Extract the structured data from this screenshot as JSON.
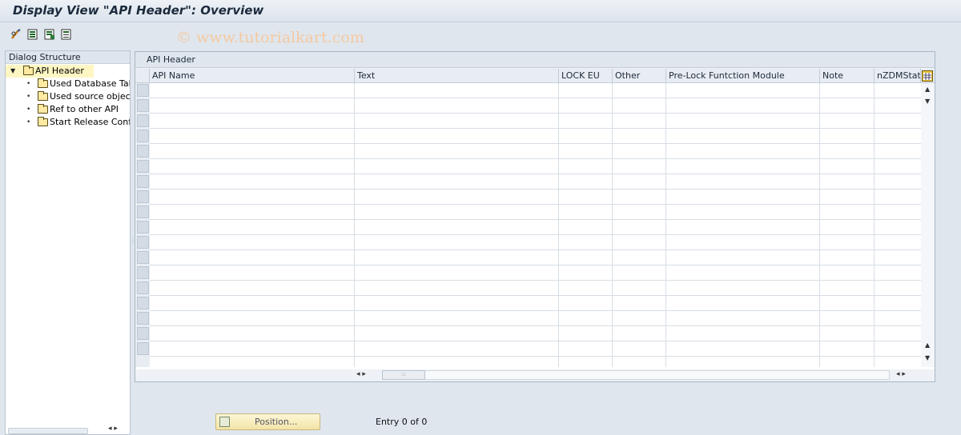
{
  "window": {
    "title": "Display View \"API Header\": Overview",
    "watermark": "© www.tutorialkart.com"
  },
  "toolbar": {
    "buttons": [
      {
        "icon": "glasses-change-icon"
      },
      {
        "icon": "select-all-icon"
      },
      {
        "icon": "deselect-icon"
      },
      {
        "icon": "select-block-icon"
      }
    ]
  },
  "dialog_structure": {
    "header": "Dialog Structure",
    "root": {
      "label": "API Header",
      "expanded": true,
      "selected": true
    },
    "children": [
      {
        "label": "Used Database Table"
      },
      {
        "label": "Used source objects"
      },
      {
        "label": "Ref to other API"
      },
      {
        "label": "Start Release Configu"
      }
    ]
  },
  "table": {
    "title": "API Header",
    "columns": [
      {
        "label": "API Name"
      },
      {
        "label": "Text"
      },
      {
        "label": "LOCK EU"
      },
      {
        "label": "Other"
      },
      {
        "label": "Pre-Lock Funtction Module"
      },
      {
        "label": "Note"
      },
      {
        "label": "nZDMStatu"
      }
    ],
    "row_count": 18
  },
  "footer": {
    "position_button": "Position...",
    "entry_text": "Entry 0 of 0"
  },
  "colors": {
    "background": "#dfe6ee",
    "selected_node": "#fdf6c3",
    "position_button": "#f2e4a6"
  }
}
